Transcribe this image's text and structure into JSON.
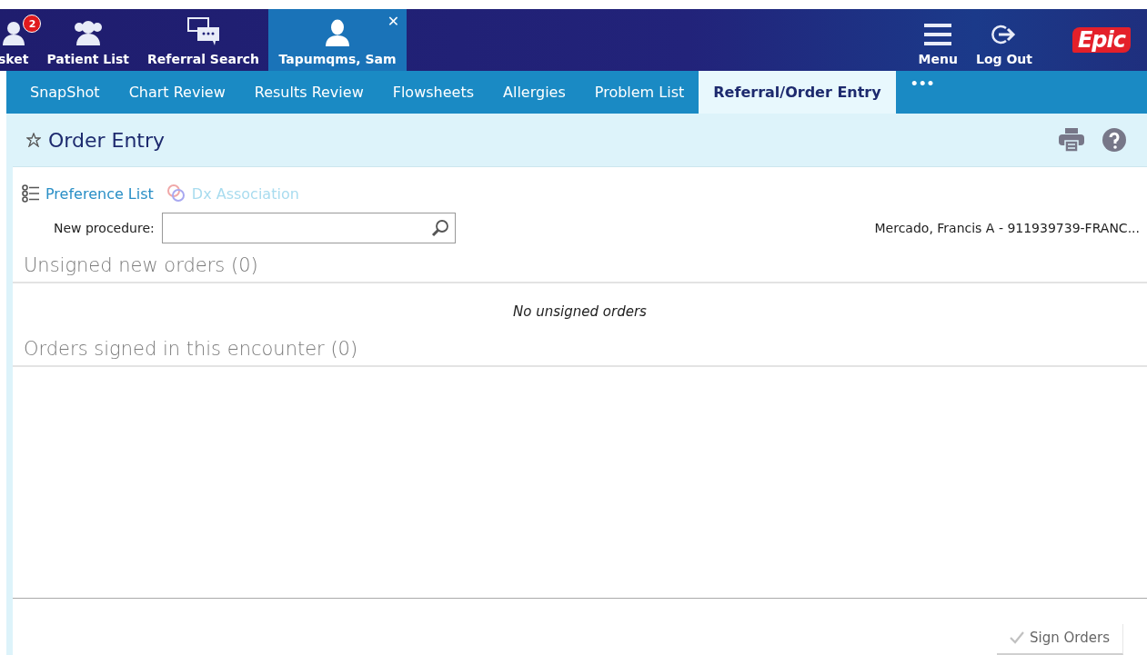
{
  "top_nav": {
    "items": [
      {
        "kind": "basket",
        "label": "sket",
        "badge": "2",
        "selected": false
      },
      {
        "kind": "people",
        "label": "Patient List",
        "selected": false
      },
      {
        "kind": "chat",
        "label": "Referral Search",
        "selected": false
      },
      {
        "kind": "person",
        "label": "Tapumqms, Sam",
        "selected": true,
        "close": "✕"
      }
    ],
    "actions": [
      {
        "kind": "menu",
        "label": "Menu"
      },
      {
        "kind": "logout",
        "label": "Log Out"
      }
    ],
    "logo": "Epic"
  },
  "tabs": [
    {
      "label": "SnapShot",
      "selected": false
    },
    {
      "label": "Chart Review",
      "selected": false
    },
    {
      "label": "Results Review",
      "selected": false
    },
    {
      "label": "Flowsheets",
      "selected": false
    },
    {
      "label": "Allergies",
      "selected": false
    },
    {
      "label": "Problem List",
      "selected": false
    },
    {
      "label": "Referral/Order Entry",
      "selected": true
    }
  ],
  "more_tabs": "•••",
  "header": {
    "title": "Order Entry"
  },
  "toolbar": [
    {
      "kind": "list",
      "label": "Preference List",
      "disabled": false
    },
    {
      "kind": "rings",
      "label": "Dx Association",
      "disabled": true
    }
  ],
  "new_procedure": {
    "label": "New procedure:"
  },
  "encounter": "Mercado, Francis A - 911939739-FRANC...",
  "sections": [
    {
      "title": "Unsigned new orders (0)",
      "empty_text": "No unsigned orders"
    },
    {
      "title": "Orders signed in this encounter (0)"
    }
  ],
  "sign_button": {
    "label": "Sign Orders",
    "disabled": true
  }
}
